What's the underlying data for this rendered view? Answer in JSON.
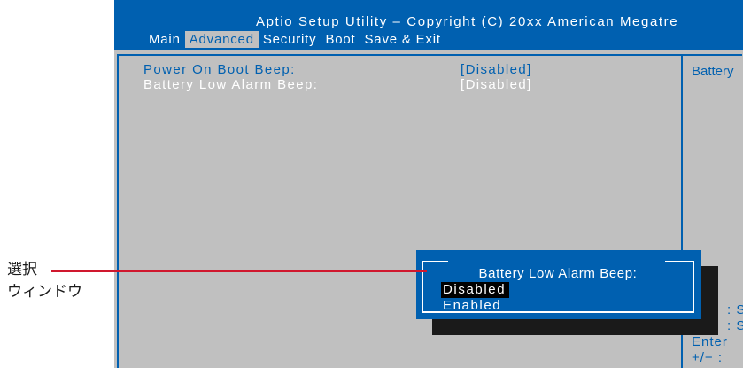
{
  "header": {
    "title": "Aptio Setup  Utility – Copyright  (C)  20xx American Megatre"
  },
  "menu": [
    "Main",
    "Advanced",
    "Security",
    "Boot",
    "Save & Exit"
  ],
  "active_menu": "Advanced",
  "settings": [
    {
      "label": "Power On Boot Beep:",
      "value": "[Disabled]"
    },
    {
      "label": "Battery Low Alarm Beep:",
      "value": "[Disabled]"
    }
  ],
  "help_panel": {
    "title": "Battery",
    "keys": [
      ": S",
      ": S",
      "Enter",
      "+/−  :"
    ]
  },
  "popup": {
    "title": "Battery Low Alarm Beep:",
    "options": [
      "Disabled",
      "Enabled"
    ],
    "selected": "Disabled"
  },
  "annotation": {
    "line1": "選択",
    "line2": "ウィンドウ"
  },
  "colors": {
    "bios_blue": "#0060b0",
    "bios_gray": "#c0c0c0",
    "leader_red": "#d0182e"
  }
}
